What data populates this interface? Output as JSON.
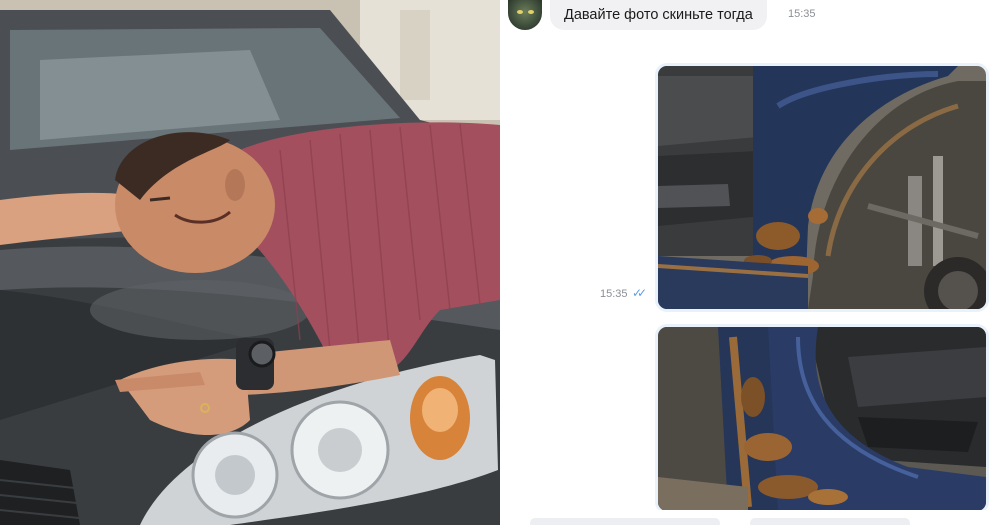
{
  "chat": {
    "incoming_message": {
      "text": "Давайте фото скиньте тогда",
      "time": "15:35"
    },
    "outgoing_photos": {
      "time": "15:35",
      "read_status": "✓✓",
      "count": 2
    }
  },
  "colors": {
    "incoming_bubble": "#f1f1f3",
    "outgoing_bubble": "#e9f1fb",
    "read_ticks": "#5b9fe3",
    "timestamp": "#8b8f96"
  },
  "icons": {
    "read_status": "double-check-icon",
    "avatar": "user-avatar"
  }
}
